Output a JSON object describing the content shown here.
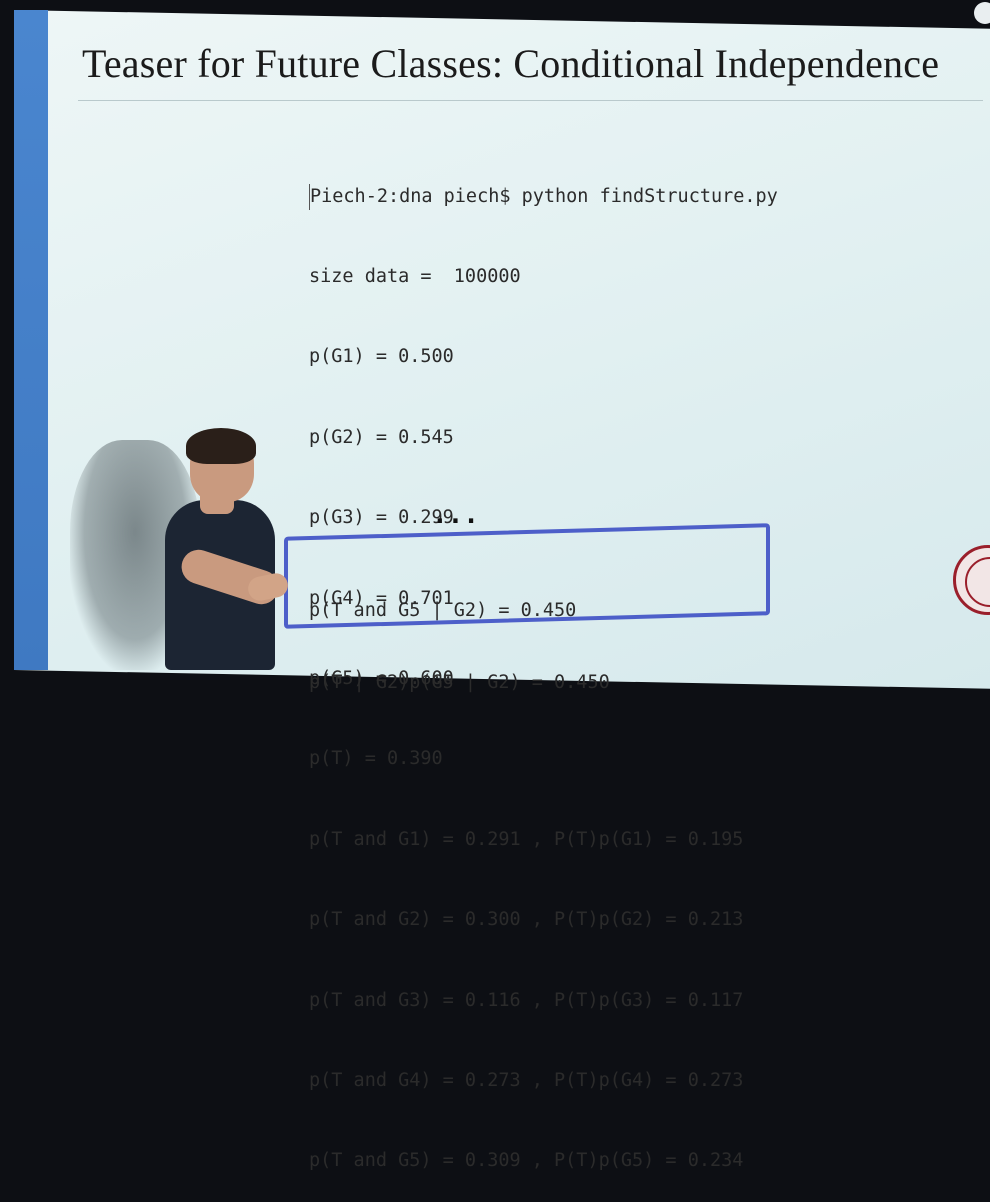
{
  "slide": {
    "title": "Teaser for Future Classes: Conditional Independence",
    "terminal_lines": [
      "Piech-2:dna piech$ python findStructure.py",
      "size data =  100000",
      "p(G1) = 0.500",
      "p(G2) = 0.545",
      "p(G3) = 0.299",
      "p(G4) = 0.701",
      "p(G5) = 0.600",
      "p(T) = 0.390",
      "p(T and G1) = 0.291 , P(T)p(G1) = 0.195",
      "p(T and G2) = 0.300 , P(T)p(G2) = 0.213",
      "p(T and G3) = 0.116 , P(T)p(G3) = 0.117",
      "p(T and G4) = 0.273 , P(T)p(G4) = 0.273",
      "p(T and G5) = 0.309 , P(T)p(G5) = 0.234"
    ],
    "ellipsis": "...",
    "highlight_lines": [
      "p(T and G5 | G2) = 0.450",
      "p(T | G2)p(G5 | G2) = 0.450"
    ]
  },
  "colors": {
    "left_bar": "#4a86cf",
    "highlight_border": "#4d5fc9",
    "seal": "#9a1f2b"
  }
}
